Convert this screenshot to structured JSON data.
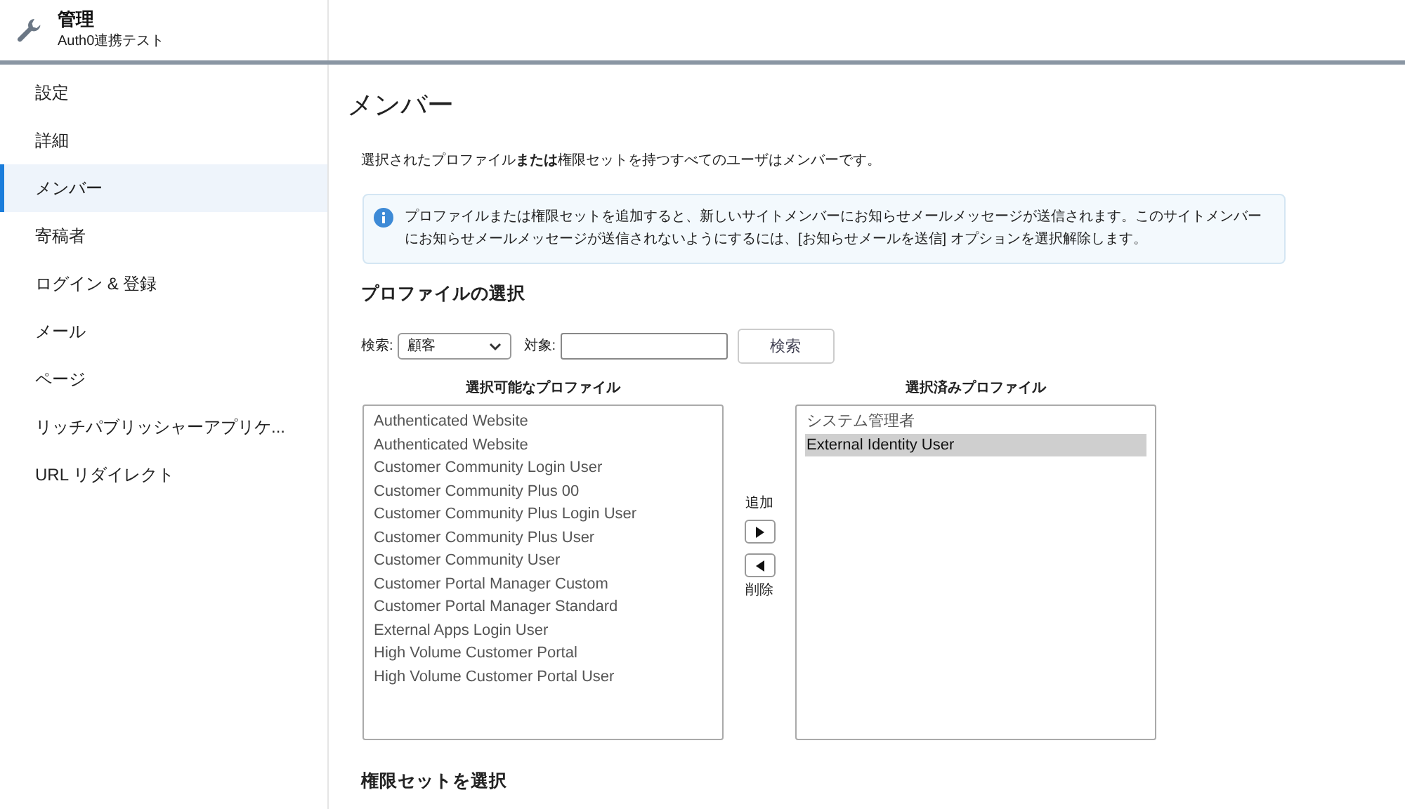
{
  "header": {
    "title": "管理",
    "subtitle": "Auth0連携テスト"
  },
  "sidebar": {
    "items": [
      {
        "label": "設定",
        "selected": false
      },
      {
        "label": "詳細",
        "selected": false
      },
      {
        "label": "メンバー",
        "selected": true
      },
      {
        "label": "寄稿者",
        "selected": false
      },
      {
        "label": "ログイン & 登録",
        "selected": false
      },
      {
        "label": "メール",
        "selected": false
      },
      {
        "label": "ページ",
        "selected": false
      },
      {
        "label": "リッチパブリッシャーアプリケ...",
        "selected": false
      },
      {
        "label": "URL リダイレクト",
        "selected": false
      }
    ]
  },
  "page_title": "メンバー",
  "description": "選択されたプロファイル**または**権限セットを持つすべてのユーザはメンバーです。",
  "info": "プロファイルまたは権限セットを追加すると、新しいサイトメンバーにお知らせメールメッセージが送信されます。このサイトメンバーにお知らせメールメッセージが送信されないようにするには、[お知らせメールを送信] オプションを選択解除します。",
  "profile_section": {
    "title": "プロファイルの選択",
    "search_label": "検索:",
    "search_select": "顧客",
    "target_label": "対象:",
    "search_button": "検索",
    "available_title": "選択可能なプロファイル",
    "available": [
      {
        "label": "Authenticated Website",
        "selected": false
      },
      {
        "label": "Authenticated Website",
        "selected": false
      },
      {
        "label": "Customer Community Login User",
        "selected": false
      },
      {
        "label": "Customer Community Plus 00",
        "selected": false
      },
      {
        "label": "Customer Community Plus Login User",
        "selected": false
      },
      {
        "label": "Customer Community Plus User",
        "selected": false
      },
      {
        "label": "Customer Community User",
        "selected": false
      },
      {
        "label": "Customer Portal Manager Custom",
        "selected": false
      },
      {
        "label": "Customer Portal Manager Standard",
        "selected": false
      },
      {
        "label": "External Apps Login User",
        "selected": false
      },
      {
        "label": "High Volume Customer Portal",
        "selected": false
      },
      {
        "label": "High Volume Customer Portal User",
        "selected": false
      }
    ],
    "add_label": "追加",
    "remove_label": "削除",
    "selected_title": "選択済みプロファイル",
    "chosen": [
      {
        "label": "システム管理者",
        "selected": false
      },
      {
        "label": "External Identity User",
        "selected": true
      }
    ]
  },
  "permission_section": {
    "title": "権限セットを選択"
  }
}
